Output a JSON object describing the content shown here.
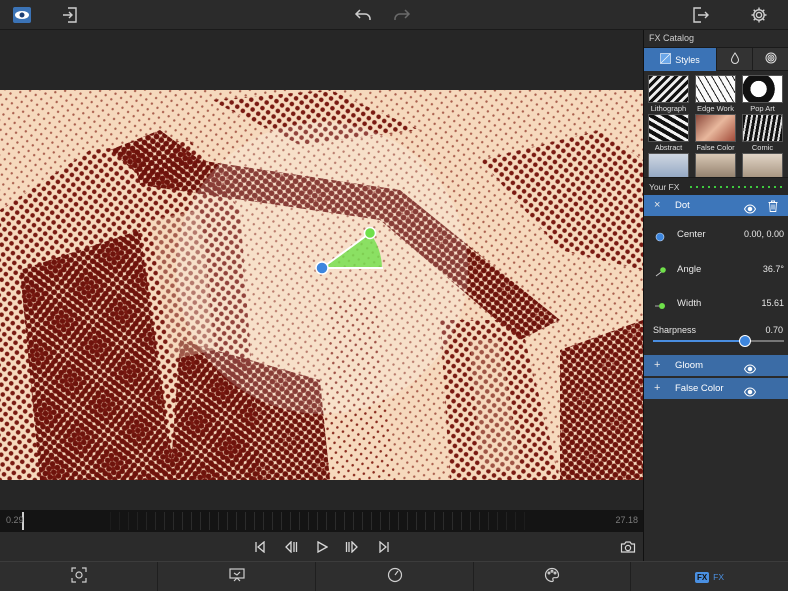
{
  "toolbar": {
    "app_icon": "eye-app-icon",
    "import": "import-icon",
    "undo": "undo-icon",
    "redo": "redo-icon",
    "export": "export-icon",
    "settings": "gear-icon"
  },
  "timeline": {
    "start": "0.29",
    "end": "27.18"
  },
  "transport": {
    "buttons": [
      "skip-start-icon",
      "step-back-icon",
      "play-icon",
      "step-forward-icon",
      "skip-end-icon",
      "camera-icon"
    ]
  },
  "panel": {
    "catalog_title": "FX Catalog",
    "tabs": [
      {
        "label": "Styles",
        "icon": "styles-icon",
        "active": true
      },
      {
        "label": "",
        "icon": "drop-icon",
        "active": false
      },
      {
        "label": "",
        "icon": "spiral-icon",
        "active": false
      }
    ],
    "thumbnails": [
      {
        "label": "Lithograph"
      },
      {
        "label": "Edge Work"
      },
      {
        "label": "Pop Art"
      },
      {
        "label": "Abstract"
      },
      {
        "label": "False Color"
      },
      {
        "label": "Comic"
      },
      {
        "label": ""
      },
      {
        "label": ""
      },
      {
        "label": ""
      }
    ],
    "your_fx_title": "Your FX",
    "fx_active": {
      "name": "Dot",
      "params": [
        {
          "name": "Center",
          "value": "0.00, 0.00",
          "icon": "center-icon"
        },
        {
          "name": "Angle",
          "value": "36.7°",
          "icon": "angle-icon"
        },
        {
          "name": "Width",
          "value": "15.61",
          "icon": "width-icon"
        }
      ],
      "sharpness_label": "Sharpness",
      "sharpness_value": "0.70",
      "sharpness_fraction": 0.7
    },
    "fx_others": [
      {
        "name": "Gloom"
      },
      {
        "name": "False Color"
      }
    ]
  },
  "bottom_nav": {
    "tabs": [
      {
        "icon": "focus-icon"
      },
      {
        "icon": "presentation-icon"
      },
      {
        "icon": "speed-icon"
      },
      {
        "icon": "palette-icon"
      },
      {
        "icon": "fx-icon",
        "label": "FX",
        "badge": "FX",
        "active": true
      }
    ]
  },
  "colors": {
    "accent": "#3d76ba",
    "halftone_dark": "#7a1a12",
    "halftone_light": "#f6d9bd",
    "handle_green": "#6fe04a",
    "handle_blue": "#3d86de"
  }
}
